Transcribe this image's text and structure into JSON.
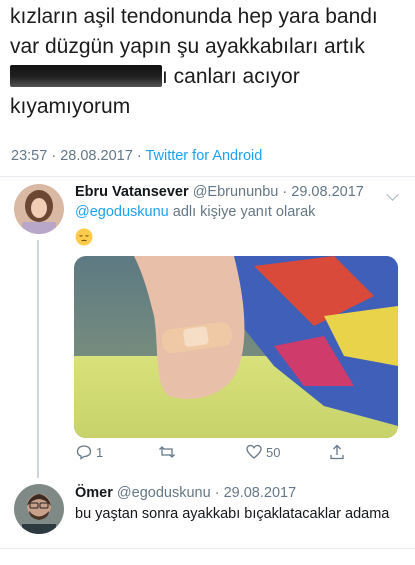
{
  "main_tweet": {
    "line1": "kızların aşil tendonunda hep yara bandı",
    "line2": "var düzgün yapın şu ayakkabıları artık",
    "line3_after_redaction": "ı canları acıyor",
    "line4": "kıyamıyorum",
    "meta": {
      "time": "23:57",
      "date": "28.08.2017",
      "separator": "·",
      "client": "Twitter for Android"
    }
  },
  "reply1": {
    "name": "Ebru Vatansever",
    "handle": "@Ebrununbu",
    "date": "29.08.2017",
    "separator": "·",
    "reply_to_handle": "@egoduskunu",
    "reply_to_suffix": " adlı kişiye yanıt olarak",
    "actions": {
      "reply_count": "1",
      "retweet_count": "",
      "like_count": "50"
    }
  },
  "reply2": {
    "name": "Ömer",
    "handle": "@egoduskunu",
    "date": "29.08.2017",
    "separator": "·",
    "text": "bu yaştan sonra ayakkabı bıçaklatacaklar adama"
  },
  "icons": [
    "reply-icon",
    "retweet-icon",
    "like-icon",
    "share-icon",
    "pensive-emoji-icon",
    "chevron-down-icon"
  ],
  "colors": {
    "link": "#1da1f2",
    "muted": "#657786",
    "text": "#14171a"
  }
}
